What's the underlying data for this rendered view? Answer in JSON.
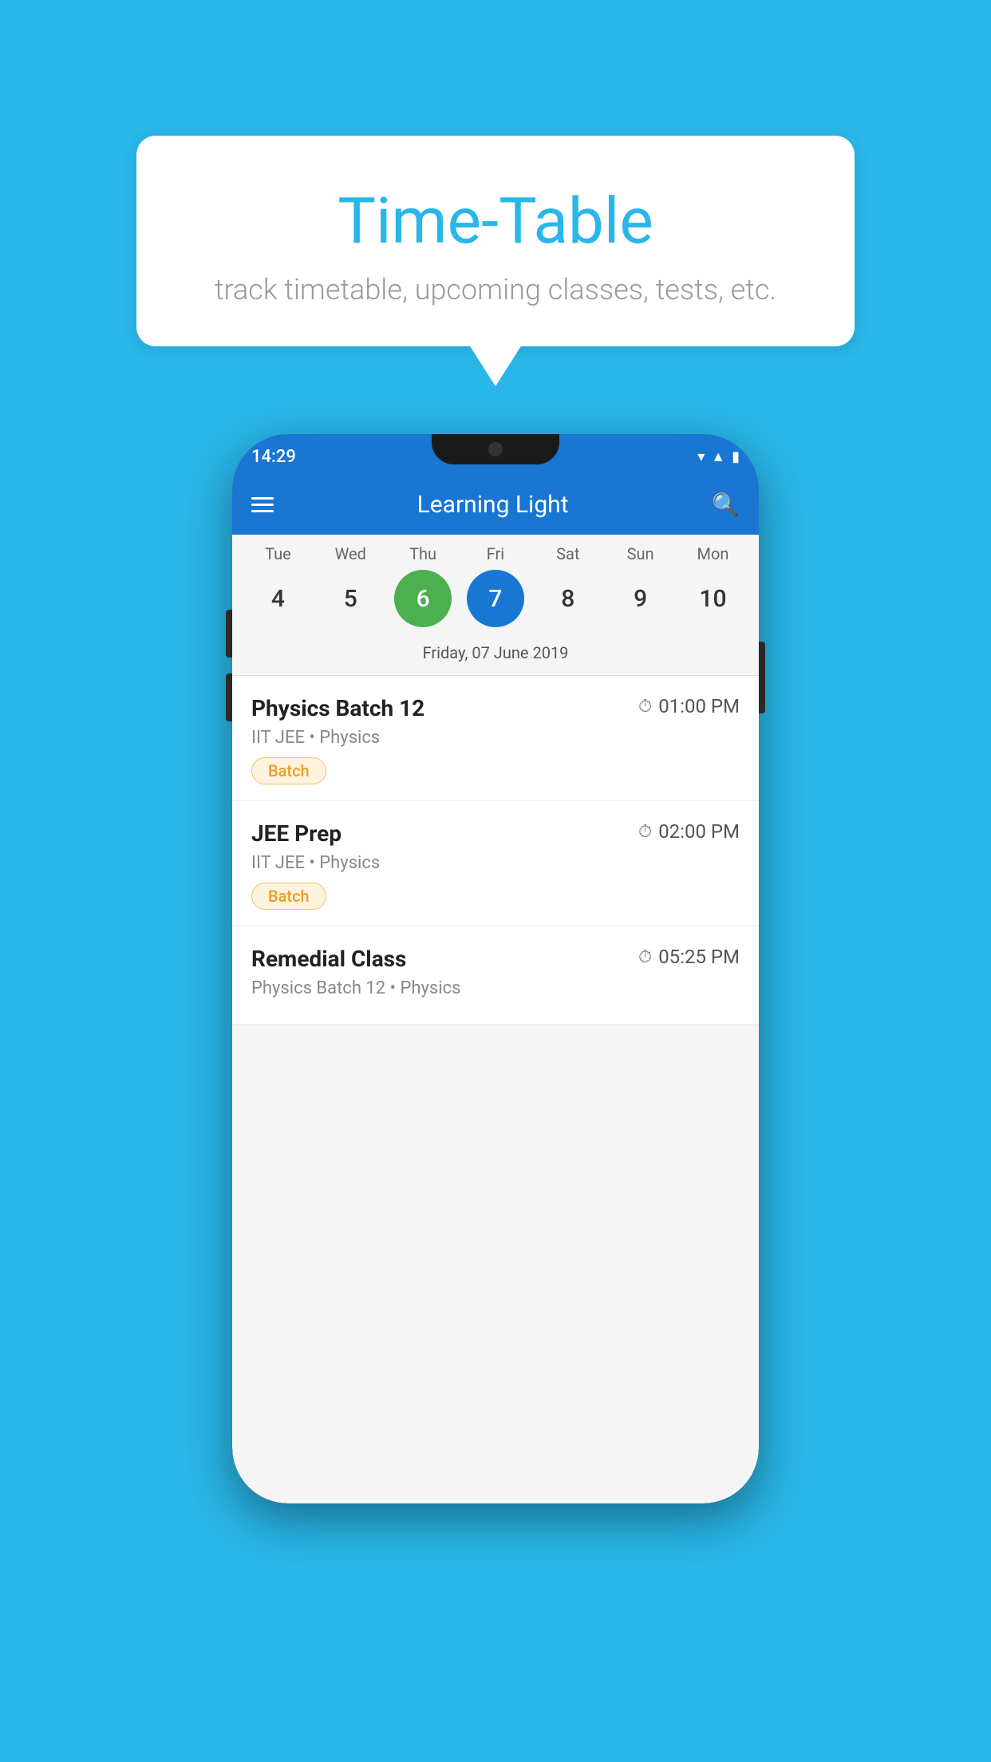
{
  "background_color": "#29b6e8",
  "speech_bubble": {
    "title": "Time-Table",
    "subtitle": "track timetable, upcoming classes, tests, etc."
  },
  "phone": {
    "status_bar": {
      "time": "14:29"
    },
    "app_bar": {
      "title": "Learning Light"
    },
    "calendar": {
      "days": [
        {
          "day": "Tue",
          "num": "4"
        },
        {
          "day": "Wed",
          "num": "5"
        },
        {
          "day": "Thu",
          "num": "6",
          "state": "today"
        },
        {
          "day": "Fri",
          "num": "7",
          "state": "selected"
        },
        {
          "day": "Sat",
          "num": "8"
        },
        {
          "day": "Sun",
          "num": "9"
        },
        {
          "day": "Mon",
          "num": "10"
        }
      ],
      "date_label": "Friday, 07 June 2019"
    },
    "classes": [
      {
        "name": "Physics Batch 12",
        "time": "01:00 PM",
        "meta": "IIT JEE • Physics",
        "badge": "Batch"
      },
      {
        "name": "JEE Prep",
        "time": "02:00 PM",
        "meta": "IIT JEE • Physics",
        "badge": "Batch"
      },
      {
        "name": "Remedial Class",
        "time": "05:25 PM",
        "meta": "Physics Batch 12 • Physics",
        "badge": ""
      }
    ]
  }
}
